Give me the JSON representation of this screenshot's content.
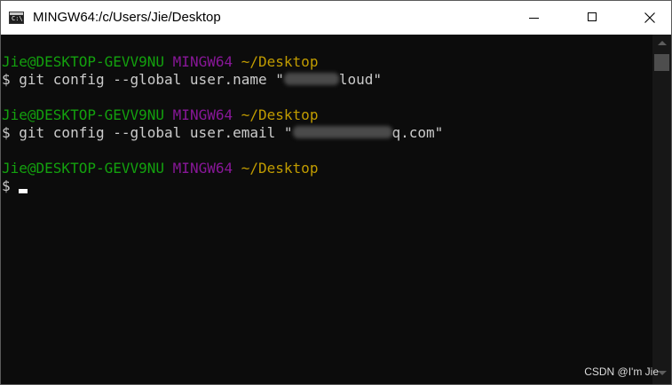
{
  "window": {
    "icon_text": "C:\\",
    "title": "MINGW64:/c/Users/Jie/Desktop",
    "icons": {
      "app": "console-icon",
      "minimize": "minimize-icon",
      "maximize": "maximize-icon",
      "close": "close-icon"
    }
  },
  "terminal": {
    "colors": {
      "user": "#13a10e",
      "system": "#881798",
      "path": "#c19c00",
      "text": "#cccccc",
      "background": "#0c0c0c"
    },
    "prompts": [
      {
        "user_host": "Jie@DESKTOP-GEVV9NU",
        "system": "MINGW64",
        "path": "~/Desktop"
      },
      {
        "user_host": "Jie@DESKTOP-GEVV9NU",
        "system": "MINGW64",
        "path": "~/Desktop"
      },
      {
        "user_host": "Jie@DESKTOP-GEVV9NU",
        "system": "MINGW64",
        "path": "~/Desktop"
      }
    ],
    "commands": [
      {
        "prefix": "$ git config --global user.name \"",
        "visible_tail": "loud\""
      },
      {
        "prefix": "$ git config --global user.email \"",
        "visible_tail": "q.com\""
      }
    ],
    "current_prompt_symbol": "$"
  },
  "watermark": "CSDN @I'm Jie"
}
